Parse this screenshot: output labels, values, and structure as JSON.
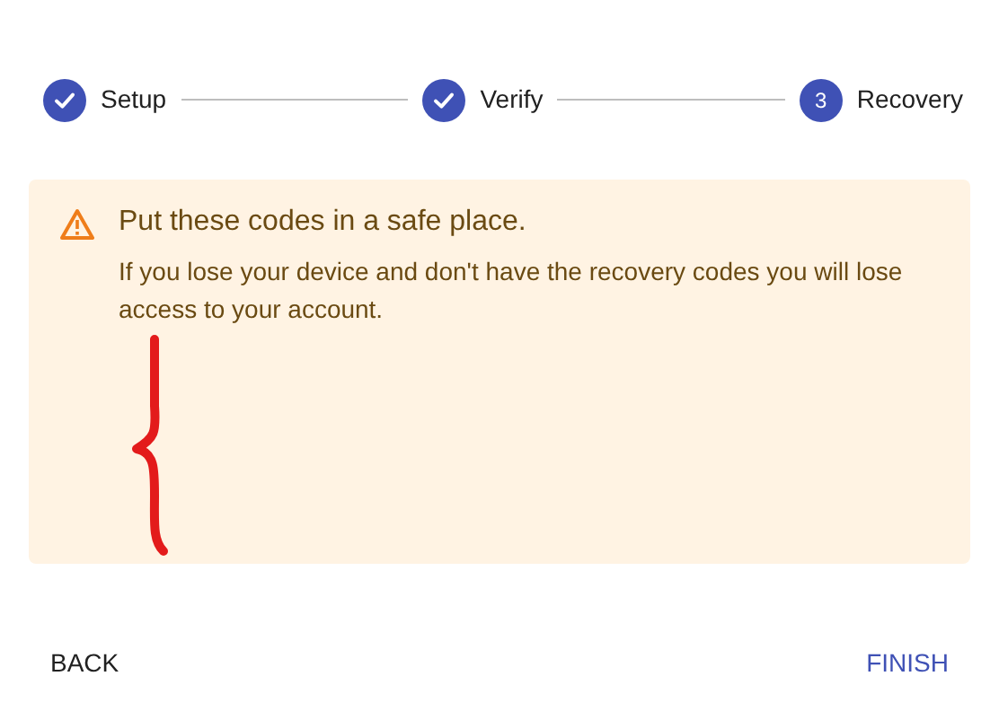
{
  "steps": [
    {
      "label": "Setup",
      "completed": true
    },
    {
      "label": "Verify",
      "completed": true
    },
    {
      "label": "Recovery",
      "completed": false,
      "number": "3"
    }
  ],
  "alert": {
    "title": "Put these codes in a safe place.",
    "message": "If you lose your device and don't have the recovery codes you will lose access to your account."
  },
  "buttons": [
    {
      "label": "BACK",
      "kind": "secondary"
    },
    {
      "label": "FINISH",
      "kind": "primary"
    }
  ]
}
